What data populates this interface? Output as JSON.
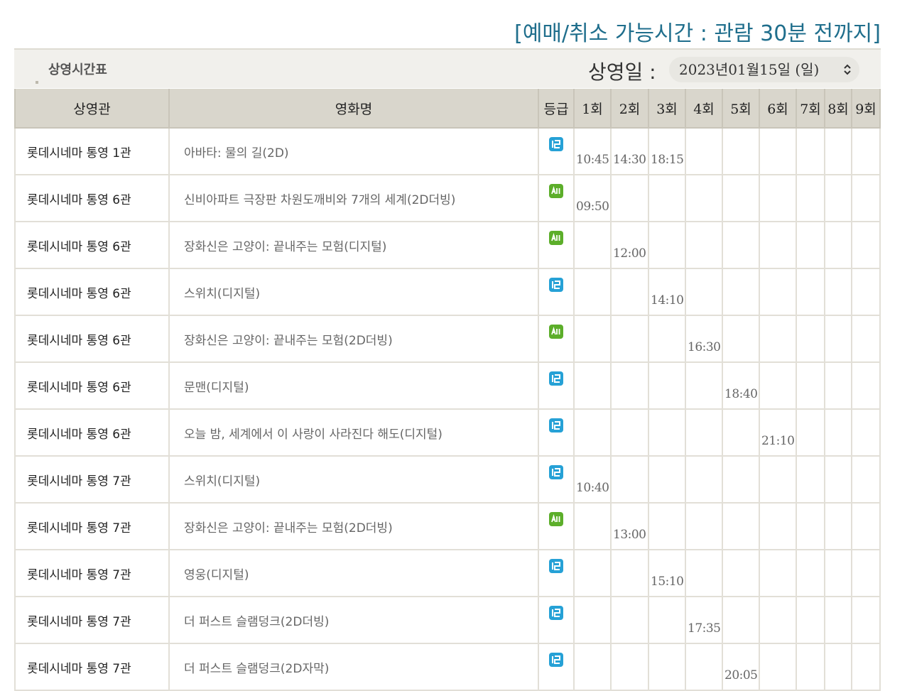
{
  "notice": "[예매/취소 가능시간 : 관람 30분 전까지]",
  "header": {
    "section_title": "상영시간표",
    "date_label": "상영일 :",
    "date_value": "2023년01월15일 (일)",
    "date_icon": "chevron-up-down-icon"
  },
  "columns": [
    "상영관",
    "영화명",
    "등급",
    "1회",
    "2회",
    "3회",
    "4회",
    "5회",
    "6회",
    "7회",
    "8회",
    "9회"
  ],
  "rows": [
    {
      "theater": "롯데시네마 통영 1관",
      "movie": "아바타: 물의 길(2D)",
      "rating": "12",
      "times": [
        "10:45",
        "14:30",
        "18:15",
        "",
        "",
        "",
        "",
        "",
        ""
      ]
    },
    {
      "theater": "롯데시네마 통영 6관",
      "movie": "신비아파트 극장판 차원도깨비와 7개의 세계(2D더빙)",
      "rating": "All",
      "times": [
        "09:50",
        "",
        "",
        "",
        "",
        "",
        "",
        "",
        ""
      ]
    },
    {
      "theater": "롯데시네마 통영 6관",
      "movie": "장화신은 고양이: 끝내주는 모험(디지털)",
      "rating": "All",
      "times": [
        "",
        "12:00",
        "",
        "",
        "",
        "",
        "",
        "",
        ""
      ]
    },
    {
      "theater": "롯데시네마 통영 6관",
      "movie": "스위치(디지털)",
      "rating": "12",
      "times": [
        "",
        "",
        "14:10",
        "",
        "",
        "",
        "",
        "",
        ""
      ]
    },
    {
      "theater": "롯데시네마 통영 6관",
      "movie": "장화신은 고양이: 끝내주는 모험(2D더빙)",
      "rating": "All",
      "times": [
        "",
        "",
        "",
        "16:30",
        "",
        "",
        "",
        "",
        ""
      ]
    },
    {
      "theater": "롯데시네마 통영 6관",
      "movie": "문맨(디지털)",
      "rating": "12",
      "times": [
        "",
        "",
        "",
        "",
        "18:40",
        "",
        "",
        "",
        ""
      ]
    },
    {
      "theater": "롯데시네마 통영 6관",
      "movie": "오늘 밤, 세계에서 이 사랑이 사라진다 해도(디지털)",
      "rating": "12",
      "times": [
        "",
        "",
        "",
        "",
        "",
        "21:10",
        "",
        "",
        ""
      ]
    },
    {
      "theater": "롯데시네마 통영 7관",
      "movie": "스위치(디지털)",
      "rating": "12",
      "times": [
        "10:40",
        "",
        "",
        "",
        "",
        "",
        "",
        "",
        ""
      ]
    },
    {
      "theater": "롯데시네마 통영 7관",
      "movie": "장화신은 고양이: 끝내주는 모험(2D더빙)",
      "rating": "All",
      "times": [
        "",
        "13:00",
        "",
        "",
        "",
        "",
        "",
        "",
        ""
      ]
    },
    {
      "theater": "롯데시네마 통영 7관",
      "movie": "영웅(디지털)",
      "rating": "12",
      "times": [
        "",
        "",
        "15:10",
        "",
        "",
        "",
        "",
        "",
        ""
      ]
    },
    {
      "theater": "롯데시네마 통영 7관",
      "movie": "더 퍼스트 슬램덩크(2D더빙)",
      "rating": "12",
      "times": [
        "",
        "",
        "",
        "17:35",
        "",
        "",
        "",
        "",
        ""
      ]
    },
    {
      "theater": "롯데시네마 통영 7관",
      "movie": "더 퍼스트 슬램덩크(2D자막)",
      "rating": "12",
      "times": [
        "",
        "",
        "",
        "",
        "20:05",
        "",
        "",
        "",
        ""
      ]
    }
  ],
  "colors": {
    "accent": "#1f6e8c",
    "rating_12": "#26a1d6",
    "rating_all": "#5cae2a",
    "header_bg": "#d9d6cc"
  }
}
